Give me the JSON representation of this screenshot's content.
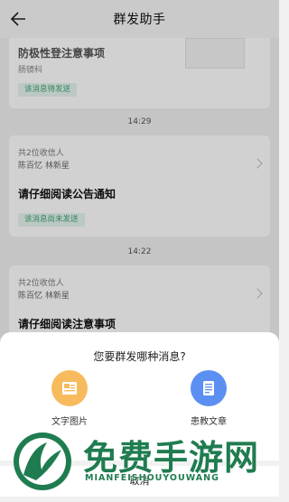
{
  "header": {
    "title": "群发助手",
    "back_icon": "arrow-left-icon"
  },
  "feed": {
    "card1": {
      "title": "防极性登注意事项",
      "sub": "肠镜科",
      "status": "该消息待发送"
    },
    "time1": "14:29",
    "card2": {
      "recipients": "共2位收信人",
      "names": "陈百忆  林新星",
      "title": "请仔细阅读公告通知",
      "status": "该消息尚未发送"
    },
    "time2": "14:22",
    "card3": {
      "recipients": "共2位收信人",
      "names": "陈百忆  林新星",
      "title": "请仔细阅读注意事项"
    }
  },
  "sheet": {
    "title": "您要群发哪种消息?",
    "options": [
      {
        "label": "文字图片",
        "icon": "image-text-icon",
        "color": "#f5b85a"
      },
      {
        "label": "患教文章",
        "icon": "document-icon",
        "color": "#5a8ff5"
      }
    ],
    "cancel": "取消"
  },
  "watermark": {
    "text": "免费手游网",
    "sub": "MIANFEISHOUYOUWANG"
  },
  "colors": {
    "accent": "#3aa472",
    "status_bg": "#e6f4ee"
  }
}
